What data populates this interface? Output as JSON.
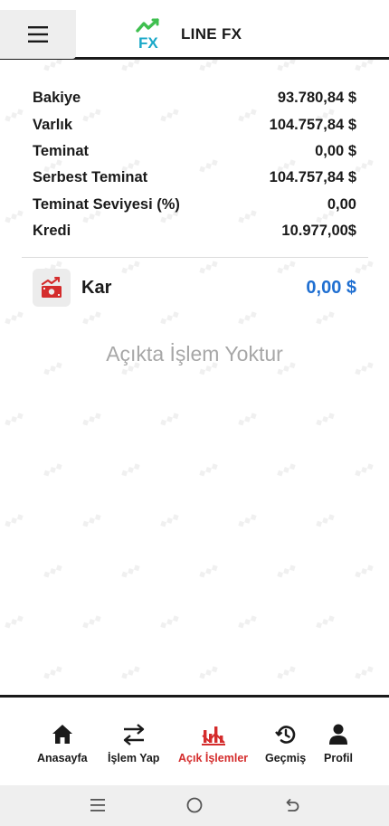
{
  "header": {
    "brand_name": "LINE FX",
    "logo_text": "FX",
    "menu_icon": "hamburger-icon"
  },
  "account": {
    "rows": [
      {
        "label": "Bakiye",
        "value": "93.780,84 $"
      },
      {
        "label": "Varlık",
        "value": "104.757,84 $"
      },
      {
        "label": "Teminat",
        "value": "0,00 $"
      },
      {
        "label": "Serbest Teminat",
        "value": "104.757,84 $"
      },
      {
        "label": "Teminat Seviyesi (%)",
        "value": "0,00"
      },
      {
        "label": "Kredi",
        "value": "10.977,00$"
      }
    ]
  },
  "profit": {
    "icon": "money-chart-icon",
    "label": "Kar",
    "value": "0,00 $"
  },
  "empty_state": "Açıkta İşlem Yoktur",
  "bottom_nav": {
    "items": [
      {
        "label": "Anasayfa",
        "icon": "home-icon",
        "active": false
      },
      {
        "label": "İşlem Yap",
        "icon": "exchange-arrows-icon",
        "active": false
      },
      {
        "label": "Açık İşlemler",
        "icon": "open-trades-icon",
        "active": true
      },
      {
        "label": "Geçmiş",
        "icon": "history-icon",
        "active": false
      },
      {
        "label": "Profil",
        "icon": "person-icon",
        "active": false
      }
    ]
  },
  "system_bar": {
    "buttons": [
      "recent-apps-icon",
      "home-circle-icon",
      "back-icon"
    ]
  },
  "colors": {
    "accent_blue": "#1f6fd1",
    "active_red": "#d42c2c",
    "logo_green": "#3fbf4f",
    "logo_teal": "#1aa8c8"
  }
}
